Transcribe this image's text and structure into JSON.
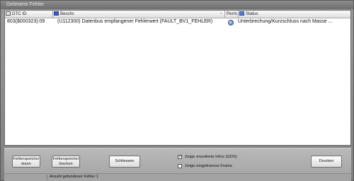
{
  "window": {
    "title": "Gelesene Fehler"
  },
  "table": {
    "columns": [
      {
        "label": "DTC ID",
        "icon": "dtc-icon"
      },
      {
        "label": "Beschr.",
        "icon": "description-icon"
      },
      {
        "label": "Perm."
      },
      {
        "label": "Status",
        "icon": "status-icon"
      }
    ],
    "rows": [
      {
        "dtc_id": "803($000323):09",
        "description": "(U112300) Datenbus empfangener Fehlerwert (FAULT_BV1_FEHLER)",
        "perm_icon": "info-dot-icon",
        "status": "Unterbrechung/Kurzschluss nach Masse ..."
      }
    ]
  },
  "buttons": {
    "read": "Fehlerspeicher\nlesen",
    "clear": "Fehlerspeicher\nlöschen",
    "close": "Schliessen",
    "print": "Drucken"
  },
  "options": {
    "extended_info": {
      "label": "Zeige erweiterte Infos (GDS)",
      "checked": true
    },
    "freeze_frame": {
      "label": "Zeige eingefrorene Frame",
      "checked": false
    }
  },
  "statusbar": {
    "text": "Anzahl gefundener Fehler 1"
  },
  "colors": {
    "window_bg": "#8f8f8f",
    "list_bg": "#ffffff",
    "panel_bg": "#b0b0b0"
  }
}
